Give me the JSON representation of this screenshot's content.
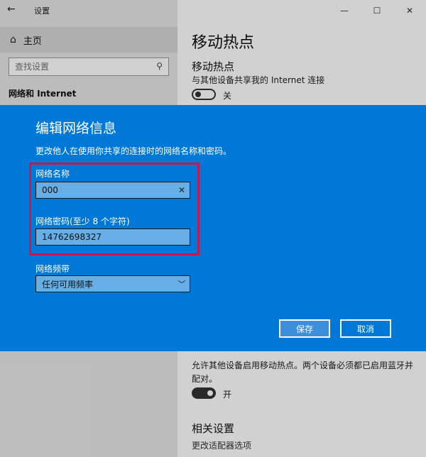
{
  "window": {
    "title": "设置",
    "back_icon": "←",
    "controls": [
      "—",
      "☐",
      "✕"
    ]
  },
  "sidebar": {
    "home_icon": "⌂",
    "home_label": "主页",
    "search_placeholder": "查找设置",
    "search_icon": "⚲",
    "section": "网络和 Internet"
  },
  "main": {
    "page_title": "移动热点",
    "hotspot": {
      "title": "移动热点",
      "desc": "与其他设备共享我的 Internet 连接",
      "toggle_label": "关"
    },
    "bluetooth": {
      "desc": "允许其他设备启用移动热点。两个设备必须都已启用蓝牙并配对。",
      "toggle_label": "开"
    },
    "related": {
      "title": "相关设置",
      "link": "更改适配器选项"
    }
  },
  "dialog": {
    "title": "编辑网络信息",
    "desc": "更改他人在使用你共享的连接时的网络名称和密码。",
    "name_label": "网络名称",
    "name_value": "000",
    "clear_icon": "✕",
    "password_label": "网络密码(至少 8 个字符)",
    "password_value": "14762698327",
    "band_label": "网络频带",
    "band_value": "任何可用频率",
    "band_chevron": "﹀",
    "save_label": "保存",
    "cancel_label": "取消",
    "highlight_color": "#c8174f",
    "accent_color": "#0078d7"
  }
}
